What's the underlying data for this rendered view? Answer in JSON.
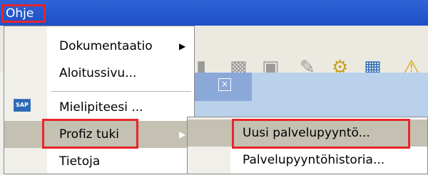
{
  "menubar": {
    "help_label": "Ohje"
  },
  "toolbar": {
    "icons": [
      "save-icon",
      "copy-icon",
      "print-icon",
      "edit-icon",
      "settings-icon",
      "chart-icon",
      "warning-icon"
    ]
  },
  "menu": {
    "items": [
      {
        "label": "Dokumentaatio",
        "has_submenu": true
      },
      {
        "label": "Aloitussivu..."
      },
      {
        "label": "Mielipiteesi ...",
        "icon": "sap-icon"
      },
      {
        "label": "Profiz tuki",
        "has_submenu": true,
        "active": true
      },
      {
        "label": "Tietoja"
      }
    ],
    "sap_icon_text": "SAP"
  },
  "submenu": {
    "items": [
      {
        "label": "Uusi palvelupyyntö...",
        "active": true
      },
      {
        "label": "Palvelupyyntöhistoria..."
      }
    ]
  },
  "colors": {
    "highlight": "#e8252a",
    "menubar": "#2f63d6",
    "active_item": "#c4c0b2"
  }
}
